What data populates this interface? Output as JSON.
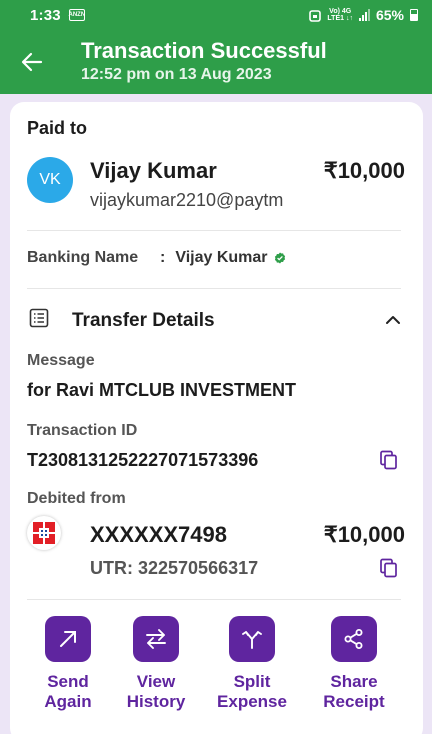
{
  "status_bar": {
    "time": "1:33",
    "notification_icon_text": "ANZN",
    "network_label_top": "Vo) 4G",
    "network_label_bottom": "LTE1 ↓↑",
    "battery": "65%"
  },
  "header": {
    "title": "Transaction Successful",
    "subtitle": "12:52 pm on 13 Aug 2023",
    "brand_color": "#2e9e49"
  },
  "paid_to": {
    "label": "Paid to",
    "avatar_initials": "VK",
    "name": "Vijay Kumar",
    "upi_id": "vijaykumar2210@paytm",
    "amount": "₹10,000"
  },
  "banking": {
    "label": "Banking Name",
    "separator": ":",
    "value": "Vijay Kumar"
  },
  "transfer_details": {
    "title": "Transfer Details",
    "message_label": "Message",
    "message_value": "for Ravi MTCLUB INVESTMENT",
    "txn_label": "Transaction ID",
    "txn_value": "T2308131252227071573396",
    "debited_label": "Debited from",
    "account": "XXXXXX7498",
    "utr": "UTR: 322570566317",
    "amount": "₹10,000"
  },
  "actions": [
    {
      "line1": "Send",
      "line2": "Again",
      "icon": "arrow-up-right-icon"
    },
    {
      "line1": "View",
      "line2": "History",
      "icon": "swap-arrows-icon"
    },
    {
      "line1": "Split",
      "line2": "Expense",
      "icon": "split-icon"
    },
    {
      "line1": "Share",
      "line2": "Receipt",
      "icon": "share-icon"
    }
  ],
  "accent_color": "#5f259f"
}
